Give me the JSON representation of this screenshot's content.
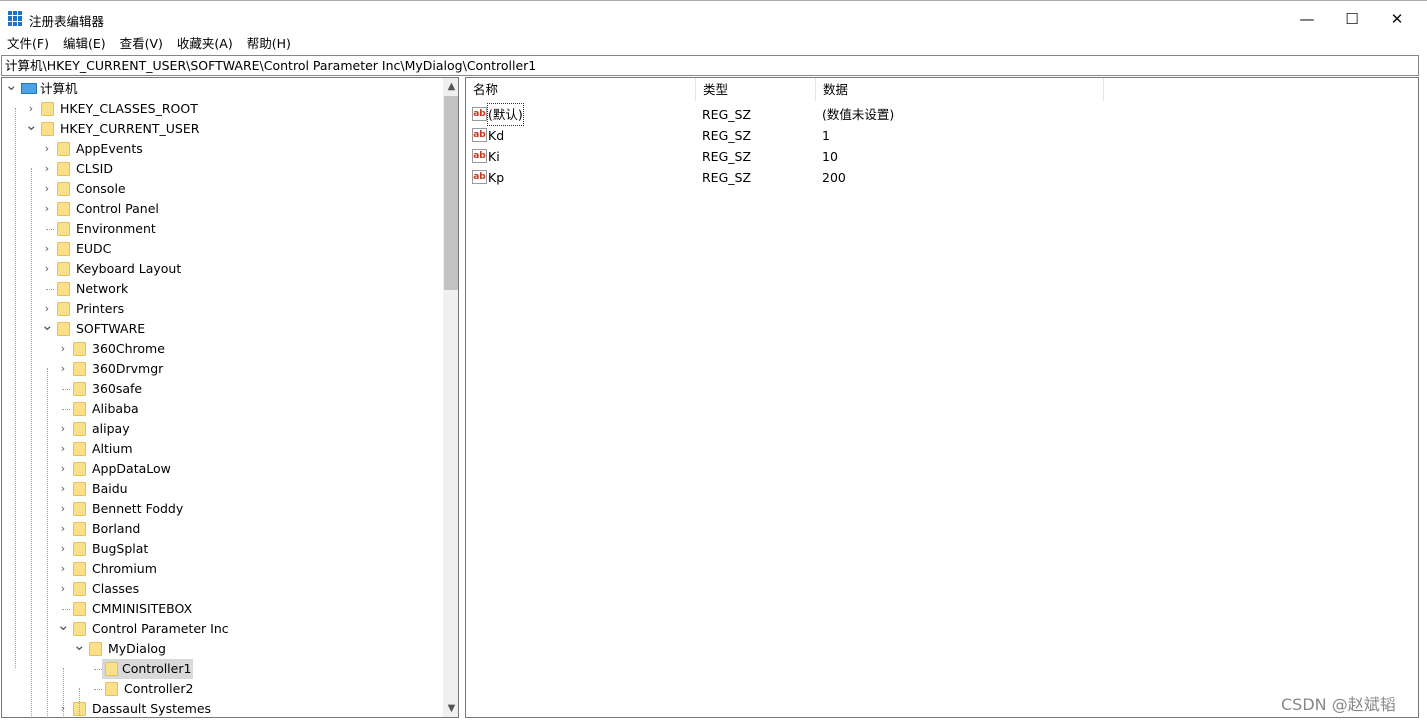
{
  "window": {
    "title": "注册表编辑器",
    "min": "—",
    "max": "☐",
    "close": "✕"
  },
  "menu": [
    "文件(F)",
    "编辑(E)",
    "查看(V)",
    "收藏夹(A)",
    "帮助(H)"
  ],
  "address": "计算机\\HKEY_CURRENT_USER\\SOFTWARE\\Control Parameter Inc\\MyDialog\\Controller1",
  "tree": [
    {
      "label": "计算机",
      "level": 0,
      "exp": "open",
      "icon": "computer"
    },
    {
      "label": "HKEY_CLASSES_ROOT",
      "level": 1,
      "exp": "closed"
    },
    {
      "label": "HKEY_CURRENT_USER",
      "level": 1,
      "exp": "open"
    },
    {
      "label": "AppEvents",
      "level": 2,
      "exp": "closed"
    },
    {
      "label": "CLSID",
      "level": 2,
      "exp": "closed"
    },
    {
      "label": "Console",
      "level": 2,
      "exp": "closed"
    },
    {
      "label": "Control Panel",
      "level": 2,
      "exp": "closed"
    },
    {
      "label": "Environment",
      "level": 2,
      "exp": "none"
    },
    {
      "label": "EUDC",
      "level": 2,
      "exp": "closed"
    },
    {
      "label": "Keyboard Layout",
      "level": 2,
      "exp": "closed"
    },
    {
      "label": "Network",
      "level": 2,
      "exp": "none"
    },
    {
      "label": "Printers",
      "level": 2,
      "exp": "closed"
    },
    {
      "label": "SOFTWARE",
      "level": 2,
      "exp": "open"
    },
    {
      "label": "360Chrome",
      "level": 3,
      "exp": "closed"
    },
    {
      "label": "360Drvmgr",
      "level": 3,
      "exp": "closed"
    },
    {
      "label": "360safe",
      "level": 3,
      "exp": "none"
    },
    {
      "label": "Alibaba",
      "level": 3,
      "exp": "none"
    },
    {
      "label": "alipay",
      "level": 3,
      "exp": "closed"
    },
    {
      "label": "Altium",
      "level": 3,
      "exp": "closed"
    },
    {
      "label": "AppDataLow",
      "level": 3,
      "exp": "closed"
    },
    {
      "label": "Baidu",
      "level": 3,
      "exp": "closed"
    },
    {
      "label": "Bennett Foddy",
      "level": 3,
      "exp": "closed"
    },
    {
      "label": "Borland",
      "level": 3,
      "exp": "closed"
    },
    {
      "label": "BugSplat",
      "level": 3,
      "exp": "closed"
    },
    {
      "label": "Chromium",
      "level": 3,
      "exp": "closed"
    },
    {
      "label": "Classes",
      "level": 3,
      "exp": "closed"
    },
    {
      "label": "CMMINISITEBOX",
      "level": 3,
      "exp": "none"
    },
    {
      "label": "Control Parameter Inc",
      "level": 3,
      "exp": "open"
    },
    {
      "label": "MyDialog",
      "level": 4,
      "exp": "open"
    },
    {
      "label": "Controller1",
      "level": 5,
      "exp": "none",
      "selected": true
    },
    {
      "label": "Controller2",
      "level": 5,
      "exp": "none"
    },
    {
      "label": "Dassault Systemes",
      "level": 3,
      "exp": "closed"
    }
  ],
  "list": {
    "columns": [
      "名称",
      "类型",
      "数据"
    ],
    "rows": [
      {
        "name": "(默认)",
        "type": "REG_SZ",
        "data": "(数值未设置)"
      },
      {
        "name": "Kd",
        "type": "REG_SZ",
        "data": "1"
      },
      {
        "name": "Ki",
        "type": "REG_SZ",
        "data": "10"
      },
      {
        "name": "Kp",
        "type": "REG_SZ",
        "data": "200"
      }
    ]
  },
  "value_icon": "ab",
  "watermark": "CSDN @赵斌韬"
}
